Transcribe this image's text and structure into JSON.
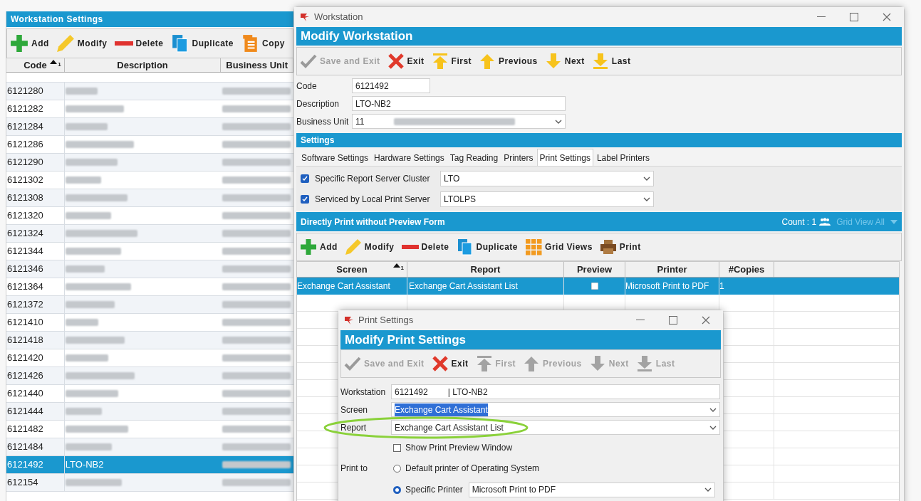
{
  "main_panel": {
    "title": "Workstation Settings",
    "toolbar": [
      {
        "kind": "add",
        "label": "Add",
        "disabled": false
      },
      {
        "kind": "modify",
        "label": "Modify",
        "disabled": false
      },
      {
        "kind": "delete",
        "label": "Delete",
        "disabled": false
      },
      {
        "kind": "duplicate",
        "label": "Duplicate",
        "disabled": false
      },
      {
        "kind": "copy",
        "label": "Copy",
        "disabled": false
      }
    ],
    "columns": [
      {
        "label": "Code",
        "sort_index": "1"
      },
      {
        "label": "Description"
      },
      {
        "label": "Business Unit"
      }
    ],
    "rows": [
      {
        "code": "6121280",
        "selected": false
      },
      {
        "code": "6121282",
        "selected": false
      },
      {
        "code": "6121284",
        "selected": false
      },
      {
        "code": "6121286",
        "selected": false
      },
      {
        "code": "6121290",
        "selected": false
      },
      {
        "code": "6121302",
        "selected": false
      },
      {
        "code": "6121308",
        "selected": false
      },
      {
        "code": "6121320",
        "selected": false
      },
      {
        "code": "6121324",
        "selected": false
      },
      {
        "code": "6121344",
        "selected": false
      },
      {
        "code": "6121346",
        "selected": false
      },
      {
        "code": "6121364",
        "selected": false
      },
      {
        "code": "6121372",
        "selected": false
      },
      {
        "code": "6121410",
        "selected": false
      },
      {
        "code": "6121418",
        "selected": false
      },
      {
        "code": "6121420",
        "selected": false
      },
      {
        "code": "6121426",
        "selected": false
      },
      {
        "code": "6121440",
        "selected": false
      },
      {
        "code": "6121444",
        "selected": false
      },
      {
        "code": "6121482",
        "selected": false
      },
      {
        "code": "6121484",
        "selected": false
      },
      {
        "code": "6121492",
        "description": "LTO-NB2",
        "selected": true
      },
      {
        "code": "612154",
        "selected": false
      }
    ]
  },
  "workstation_window": {
    "title": "Workstation",
    "header": "Modify Workstation",
    "toolbar": [
      {
        "kind": "save",
        "label": "Save and Exit",
        "disabled": true
      },
      {
        "kind": "exit",
        "label": "Exit",
        "disabled": false
      },
      {
        "kind": "first",
        "label": "First",
        "disabled": false
      },
      {
        "kind": "previous",
        "label": "Previous",
        "disabled": false
      },
      {
        "kind": "next",
        "label": "Next",
        "disabled": false
      },
      {
        "kind": "last",
        "label": "Last",
        "disabled": false
      }
    ],
    "fields": [
      {
        "kind": "text",
        "label": "Code",
        "value": "6121492"
      },
      {
        "kind": "text",
        "label": "Description",
        "value": "LTO-NB2"
      },
      {
        "kind": "select",
        "label": "Business Unit",
        "value": "11"
      }
    ],
    "settings_title": "Settings",
    "tabs": [
      {
        "label": "Software Settings",
        "selected": false
      },
      {
        "label": "Hardware Settings",
        "selected": false
      },
      {
        "label": "Tag Reading",
        "selected": false
      },
      {
        "label": "Printers",
        "selected": false
      },
      {
        "label": "Print Settings",
        "selected": true
      },
      {
        "label": "Label Printers",
        "selected": false
      }
    ],
    "options": [
      {
        "label": "Specific Report Server Cluster",
        "checked": true,
        "value": "LTO"
      },
      {
        "label": "Serviced by Local Print Server",
        "checked": true,
        "value": "LTOLPS"
      }
    ],
    "grid": {
      "title": "Directly Print without Preview Form",
      "count": "Count : 1",
      "view_label": "Grid View All",
      "toolbar": [
        {
          "kind": "add",
          "label": "Add",
          "disabled": false
        },
        {
          "kind": "modify",
          "label": "Modify",
          "disabled": false
        },
        {
          "kind": "delete",
          "label": "Delete",
          "disabled": false
        },
        {
          "kind": "duplicate",
          "label": "Duplicate",
          "disabled": false
        },
        {
          "kind": "grid_views",
          "label": "Grid Views",
          "disabled": false
        },
        {
          "kind": "print",
          "label": "Print",
          "disabled": false
        }
      ],
      "columns": [
        {
          "label": "Screen",
          "sort_index": "1"
        },
        {
          "label": "Report"
        },
        {
          "label": "Preview"
        },
        {
          "label": "Printer"
        },
        {
          "label": "#Copies"
        }
      ],
      "rows": [
        {
          "screen": "Exchange Cart Assistant",
          "report": "Exchange Cart Assistant List",
          "preview": false,
          "printer": "Microsoft Print to PDF",
          "copies": "1",
          "selected": true
        }
      ]
    }
  },
  "print_window": {
    "title": "Print Settings",
    "header": "Modify Print Settings",
    "toolbar": [
      {
        "kind": "save",
        "label": "Save and Exit",
        "disabled": true
      },
      {
        "kind": "exit",
        "label": "Exit",
        "disabled": false
      },
      {
        "kind": "first",
        "label": "First",
        "disabled": true
      },
      {
        "kind": "previous",
        "label": "Previous",
        "disabled": true
      },
      {
        "kind": "next",
        "label": "Next",
        "disabled": true
      },
      {
        "kind": "last",
        "label": "Last",
        "disabled": true
      }
    ],
    "workstation": {
      "label": "Workstation",
      "code": "6121492",
      "description": "| LTO-NB2"
    },
    "fields": [
      {
        "label": "Screen",
        "value": "Exchange Cart Assistant",
        "text_selected": true
      },
      {
        "label": "Report",
        "value": "Exchange Cart Assistant List",
        "text_selected": false,
        "annotated": true
      }
    ],
    "preview_option": {
      "label": "Show Print Preview Window",
      "checked": false
    },
    "print_to": {
      "label": "Print to",
      "options": [
        {
          "label": "Default printer of Operating System",
          "selected": false
        },
        {
          "label": "Specific Printer",
          "selected": true,
          "value": "Microsoft Print to PDF"
        }
      ]
    }
  }
}
